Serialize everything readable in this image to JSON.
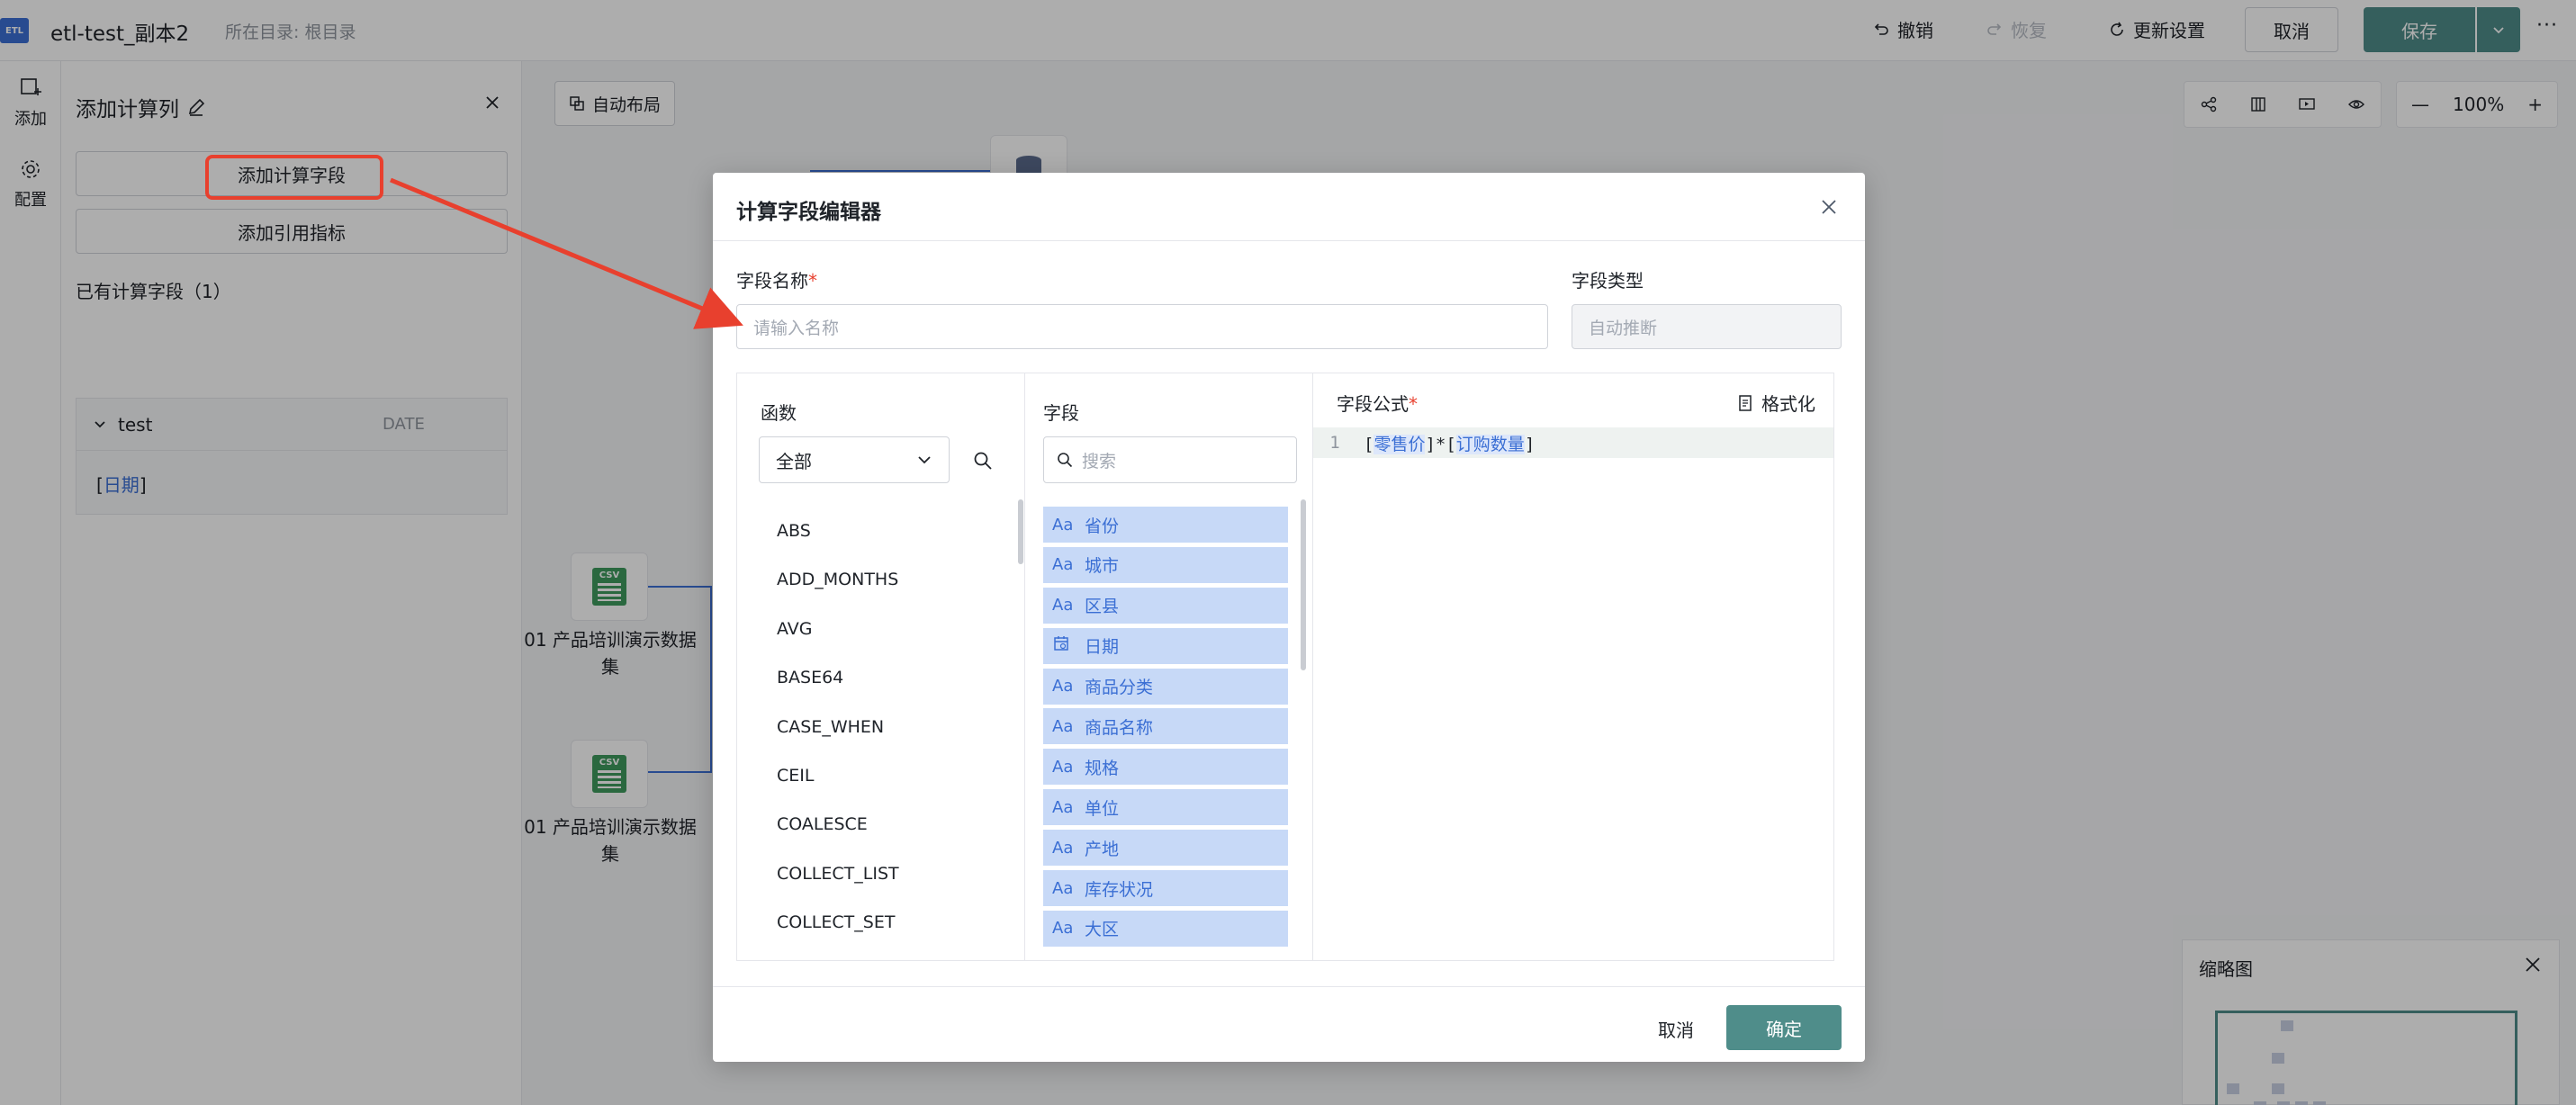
{
  "topbar": {
    "logo": "ETL",
    "title": "etl-test_副本2",
    "breadcrumb": "所在目录: 根目录",
    "undo": "撤销",
    "redo": "恢复",
    "refresh": "更新设置",
    "cancel": "取消",
    "save": "保存",
    "more": "···"
  },
  "rail": {
    "add": "添加",
    "config": "配置"
  },
  "panel": {
    "title": "添加计算列",
    "add_calc_field": "添加计算字段",
    "add_ref_metric": "添加引用指标",
    "existing": "已有计算字段（1）",
    "field_name": "test",
    "field_type": "DATE",
    "field_expr_open": "[",
    "field_expr_ref": "日期",
    "field_expr_close": "]"
  },
  "canvas": {
    "auto_layout": "自动布局",
    "node1_label": "01 产品培训演示数据集",
    "node2_label": "01 产品培训演示数据集",
    "csv": "CSV",
    "zoom": "100%",
    "zoom_out": "—",
    "zoom_in": "+",
    "minimap_title": "缩略图"
  },
  "modal": {
    "title": "计算字段编辑器",
    "name_label": "字段名称",
    "name_placeholder": "请输入名称",
    "type_label": "字段类型",
    "type_placeholder": "自动推断",
    "func_title": "函数",
    "func_select": "全部",
    "functions": [
      "ABS",
      "ADD_MONTHS",
      "AVG",
      "BASE64",
      "CASE_WHEN",
      "CEIL",
      "COALESCE",
      "COLLECT_LIST",
      "COLLECT_SET"
    ],
    "field_title": "字段",
    "field_search_placeholder": "搜索",
    "fields": [
      {
        "icon": "Aa",
        "name": "省份"
      },
      {
        "icon": "Aa",
        "name": "城市"
      },
      {
        "icon": "Aa",
        "name": "区县"
      },
      {
        "icon": "date",
        "name": "日期"
      },
      {
        "icon": "Aa",
        "name": "商品分类"
      },
      {
        "icon": "Aa",
        "name": "商品名称"
      },
      {
        "icon": "Aa",
        "name": "规格"
      },
      {
        "icon": "Aa",
        "name": "单位"
      },
      {
        "icon": "Aa",
        "name": "产地"
      },
      {
        "icon": "Aa",
        "name": "库存状况"
      },
      {
        "icon": "Aa",
        "name": "大区"
      }
    ],
    "formula_title": "字段公式",
    "format": "格式化",
    "line_no": "1",
    "formula_ref1": "零售价",
    "formula_ref2": "订购数量",
    "cancel": "取消",
    "ok": "确定"
  },
  "colors": {
    "accent": "#4f8d8a",
    "link": "#3b6fd4",
    "highlight": "#e8402e"
  }
}
